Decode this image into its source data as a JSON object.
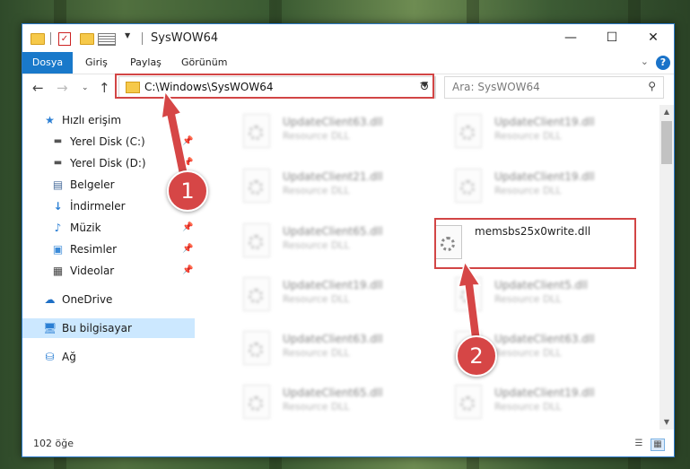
{
  "window": {
    "title": "SysWOW64"
  },
  "ribbon": {
    "tabs": [
      "Dosya",
      "Giriş",
      "Paylaş",
      "Görünüm"
    ]
  },
  "address": {
    "path": "C:\\Windows\\SysWOW64"
  },
  "search": {
    "placeholder": "Ara: SysWOW64"
  },
  "sidebar": {
    "items": [
      {
        "label": "Hızlı erişim"
      },
      {
        "label": "Yerel Disk (C:)"
      },
      {
        "label": "Yerel Disk (D:)"
      },
      {
        "label": "Belgeler"
      },
      {
        "label": "İndirmeler"
      },
      {
        "label": "Müzik"
      },
      {
        "label": "Resimler"
      },
      {
        "label": "Videolar"
      },
      {
        "label": "OneDrive"
      },
      {
        "label": "Bu bilgisayar"
      },
      {
        "label": "Ağ"
      }
    ]
  },
  "files": [
    {
      "name": "UpdateClient63.dll",
      "type": "Resource DLL"
    },
    {
      "name": "UpdateClient19.dll",
      "type": "Resource DLL"
    },
    {
      "name": "UpdateClient21.dll",
      "type": "Resource DLL"
    },
    {
      "name": "UpdateClient19.dll",
      "type": "Resource DLL"
    },
    {
      "name": "UpdateClient65.dll",
      "type": "Resource DLL"
    },
    {
      "name": "memsbs25x0write.dll",
      "type": ""
    },
    {
      "name": "UpdateClient19.dll",
      "type": "Resource DLL"
    },
    {
      "name": "UpdateClient5.dll",
      "type": "Resource DLL"
    },
    {
      "name": "UpdateClient63.dll",
      "type": "Resource DLL"
    },
    {
      "name": "UpdateClient63.dll",
      "type": "Resource DLL"
    },
    {
      "name": "UpdateClient65.dll",
      "type": "Resource DLL"
    },
    {
      "name": "UpdateClient19.dll",
      "type": "Resource DLL"
    }
  ],
  "status": {
    "count": "102 öğe"
  },
  "annotations": {
    "step1": "1",
    "step2": "2"
  },
  "colors": {
    "accent": "#1979ca",
    "highlight": "#d24545",
    "selected": "#cce8ff"
  }
}
